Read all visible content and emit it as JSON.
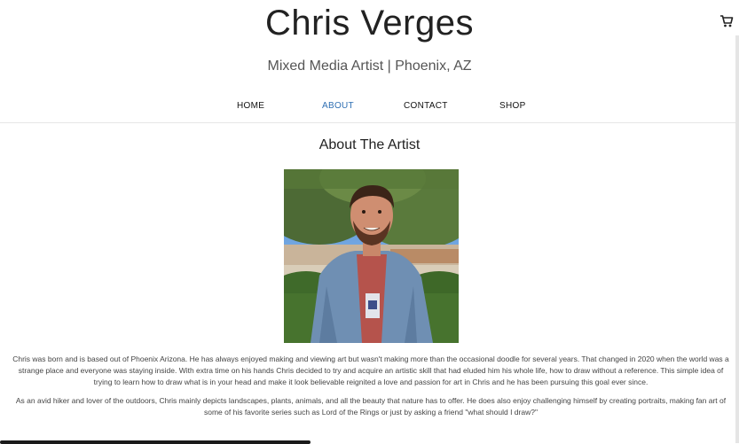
{
  "header": {
    "title": "Chris Verges",
    "subtitle": "Mixed Media Artist | Phoenix, AZ",
    "cart_icon": "shopping-cart-icon"
  },
  "nav": {
    "items": [
      {
        "label": "HOME"
      },
      {
        "label": "ABOUT",
        "active": true
      },
      {
        "label": "CONTACT"
      },
      {
        "label": "SHOP"
      }
    ],
    "active_color": "#2f6fb3"
  },
  "main": {
    "heading": "About The Artist",
    "paragraphs": [
      "Chris was born and is based out of Phoenix Arizona. He has always enjoyed making and viewing art but wasn't making more than the occasional doodle for several years. That changed in 2020 when the world was a strange place and everyone was staying inside. With extra time on his hands Chris decided to try and acquire an artistic skill that had eluded him his whole life, how to draw without a reference. This simple idea of trying to learn how to draw what is in your head and make it look believable reignited a love and passion for art in Chris and he has been pursuing this goal ever since.",
      "As an avid hiker and lover of the outdoors, Chris mainly depicts landscapes, plants, animals, and all the beauty that nature has to offer. He does also enjoy challenging himself by creating portraits, making fan art of some of his favorite series such as Lord of the Rings or just by asking a friend \"what should I draw?\""
    ]
  }
}
